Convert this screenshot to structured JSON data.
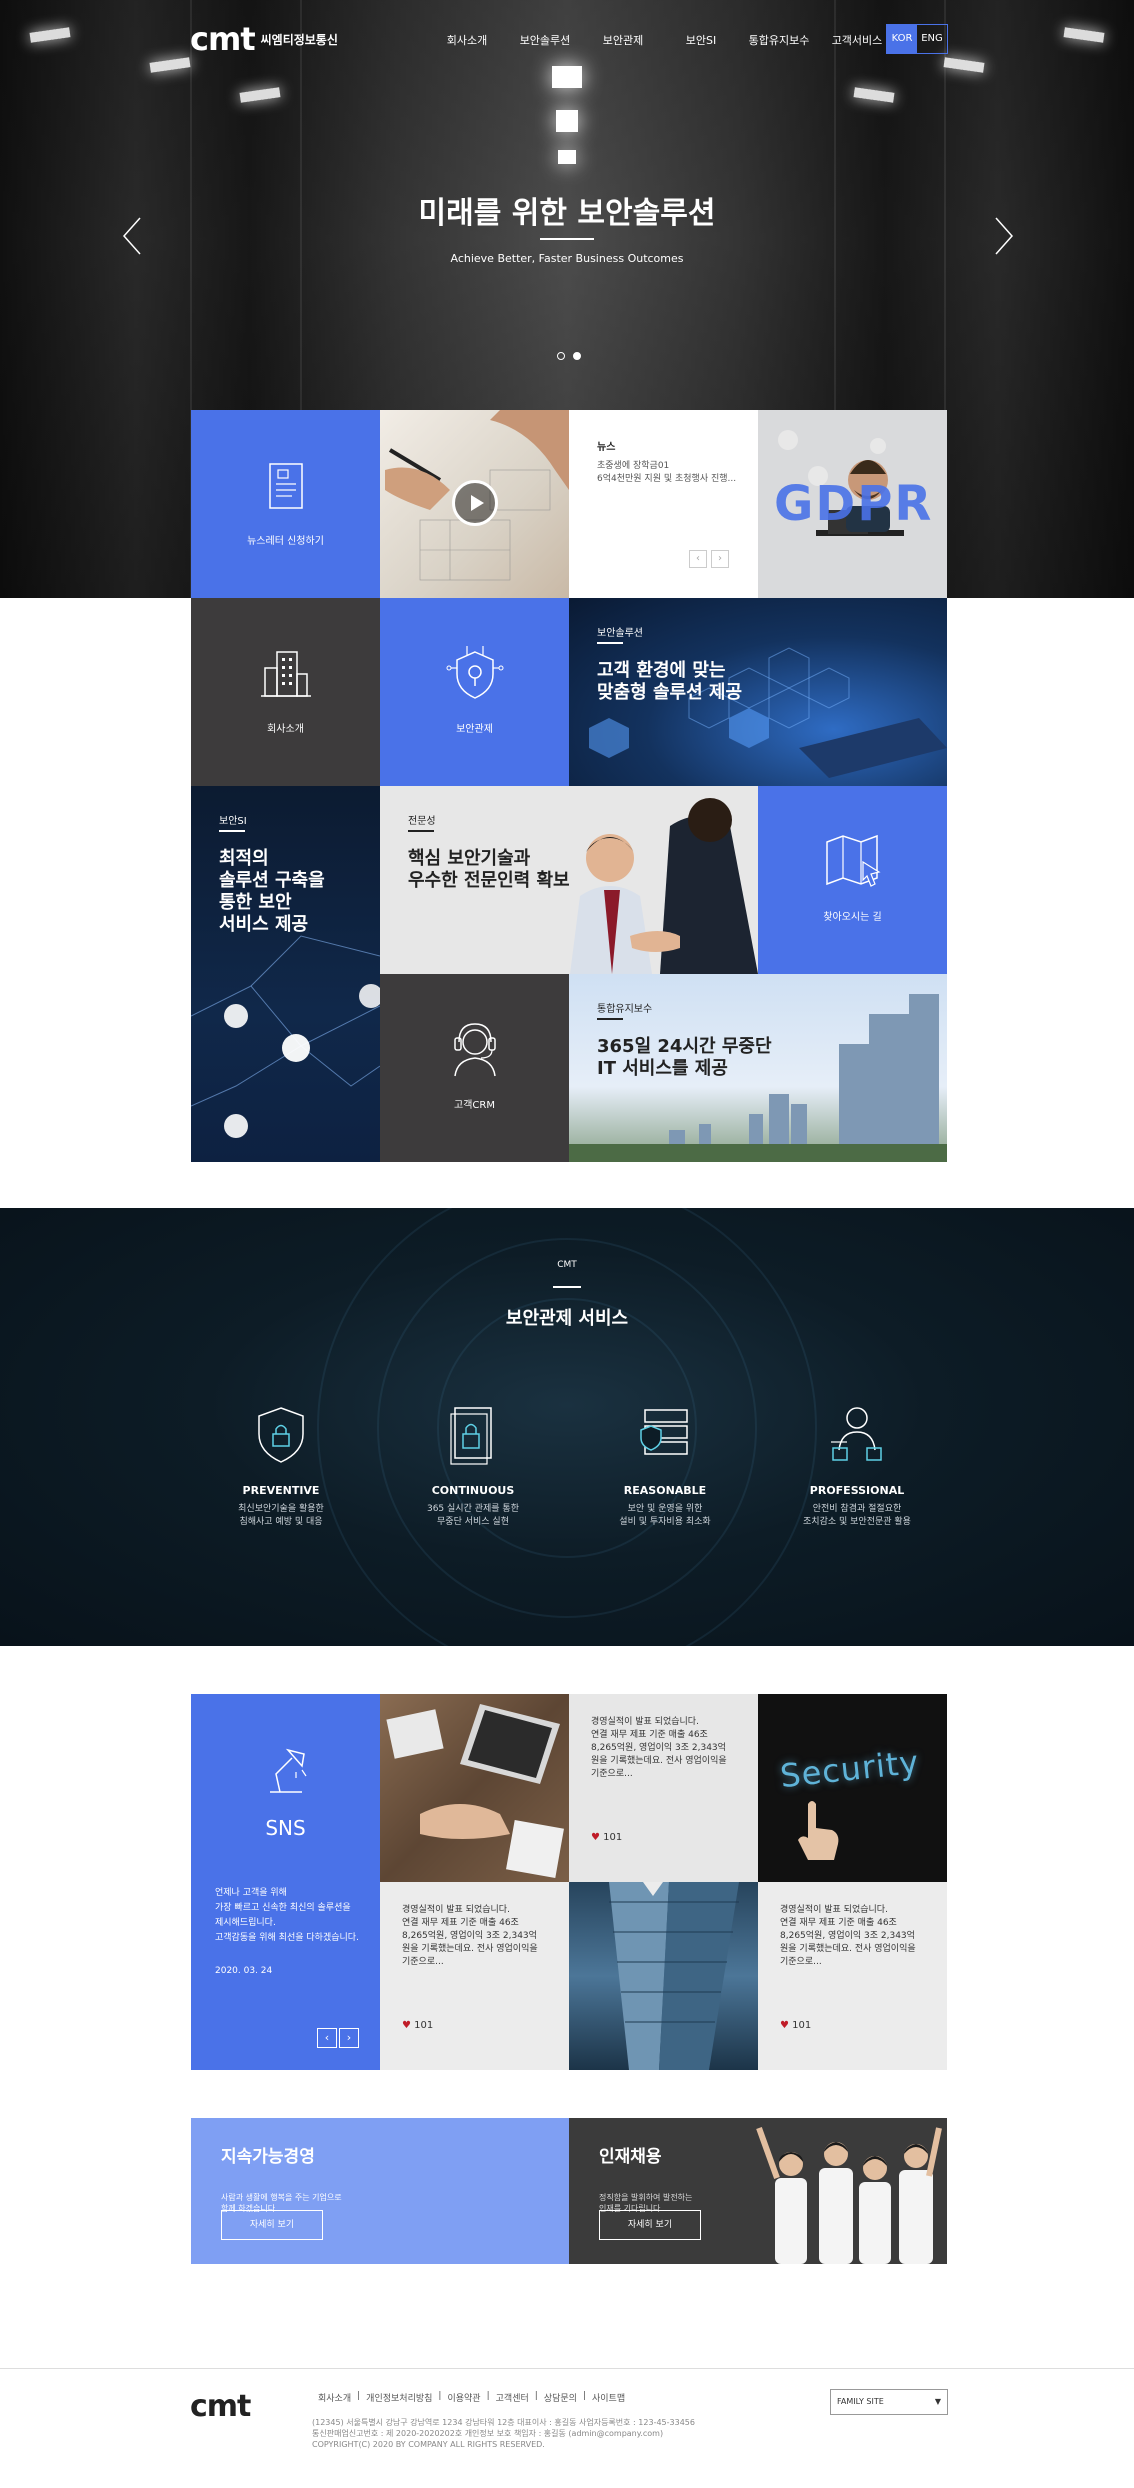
{
  "header": {
    "logo": "cmt",
    "company": "씨엠티정보통신",
    "nav": [
      "회사소개",
      "보안솔루션",
      "보안관제",
      "보안SI",
      "통합유지보수",
      "고객서비스"
    ],
    "lang": [
      "KOR",
      "ENG"
    ]
  },
  "hero": {
    "title": "미래를 위한 보안솔루션",
    "subtitle": "Achieve Better, Faster Business Outcomes",
    "prev_icon": "chevron-left-icon",
    "next_icon": "chevron-right-icon",
    "active_slide": 2,
    "slides": 2
  },
  "grid": {
    "newsletter": "뉴스레터 신청하기",
    "news": {
      "tag": "뉴스",
      "text": "초중생에 장학금01\n6억4천만원 지원 및 초청행사 진행..."
    },
    "gdpr": "GDPR",
    "company": "회사소개",
    "security_control": "보안관제",
    "solution": {
      "tag": "보안솔루션",
      "title": "고객 환경에 맞는\n맞춤형 솔루션 제공"
    },
    "si": {
      "tag": "보안SI",
      "title": "최적의\n솔루션 구축을\n통한 보안\n서비스 제공"
    },
    "expert": {
      "tag": "전문성",
      "title": "핵심 보안기술과\n우수한 전문인력 확보"
    },
    "directions": "찾아오시는 길",
    "crm": "고객CRM",
    "maintenance": {
      "tag": "통합유지보수",
      "title": "365일 24시간 무중단\nIT 서비스를 제공"
    }
  },
  "service": {
    "tag": "CMT",
    "title": "보안관제 서비스",
    "items": [
      {
        "name": "PREVENTIVE",
        "desc": "최신보안기술을 활용한\n침해사고 예방 및 대응",
        "icon": "shield-lock-icon"
      },
      {
        "name": "CONTINUOUS",
        "desc": "365 실시간 관제를 통한\n무중단 서비스 실현",
        "icon": "document-lock-icon"
      },
      {
        "name": "REASONABLE",
        "desc": "보안 및 운영을 위한\n설비 및 투자비용 최소화",
        "icon": "server-shield-icon"
      },
      {
        "name": "PROFESSIONAL",
        "desc": "안전비 참겸과 절절요한\n조치감소 및 보안전문관 활용",
        "icon": "person-lock-icon"
      }
    ]
  },
  "sns": {
    "title": "SNS",
    "desc": "언제나 고객을 위해\n가장 빠르고 신속한 최신의 솔루션을\n제시해드립니다.\n고객감동을 위해 최선을 다하겠습니다.",
    "date": "2020. 03. 24",
    "posts": [
      {
        "text": "경영실적이 발표 되었습니다.\n연결 재무 제표 기준 매출 46조\n8,265억원, 영업이익 3조 2,343억\n원을 기록했는데요. 전사 영업이익을\n기준으로...",
        "likes": "101"
      },
      {
        "text": "경영실적이 발표 되었습니다.\n연결 재무 제표 기준 매출 46조\n8,265억원, 영업이익 3조 2,343억\n원을 기록했는데요. 전사 영업이익을\n기준으로...",
        "likes": "101"
      },
      {
        "text": "경영실적이 발표 되었습니다.\n연결 재무 제표 기준 매출 46조\n8,265억원, 영업이익 3조 2,343억\n원을 기록했는데요. 전사 영업이익을\n기준으로...",
        "likes": "101"
      }
    ],
    "security_word": "Security"
  },
  "banners": {
    "sustain": {
      "title": "지속가능경영",
      "desc": "사람과 생활에 행복을 주는 기업으로\n함께 하겠습니다.",
      "button": "자세히 보기"
    },
    "recruit": {
      "title": "인재채용",
      "desc": "정직함을 발휘하여 발전하는\n인재를 기다립니다.",
      "button": "자세히 보기"
    }
  },
  "footer": {
    "logo": "cmt",
    "links": [
      "회사소개",
      "개인정보처리방침",
      "이용약관",
      "고객센터",
      "상담문의",
      "사이트맵"
    ],
    "address": "(12345) 서울특별시 강남구 강남역로 1234 강남타워 12층 대표이사 : 홍길동 사업자등록번호 : 123-45-33456",
    "registration": "통신판매업신고번호 : 제 2020-2020202호 개인정보 보호 책임자 : 홍길동 (admin@company.com)",
    "copyright": "COPYRIGHT(C) 2020 BY COMPANY ALL RIGHTS RESERVED.",
    "family_site": "FAMILY SITE"
  },
  "colors": {
    "accent": "#4a72e8",
    "dark": "#3d3b3c",
    "navy": "#0d1c26",
    "heart": "#c01c28"
  }
}
